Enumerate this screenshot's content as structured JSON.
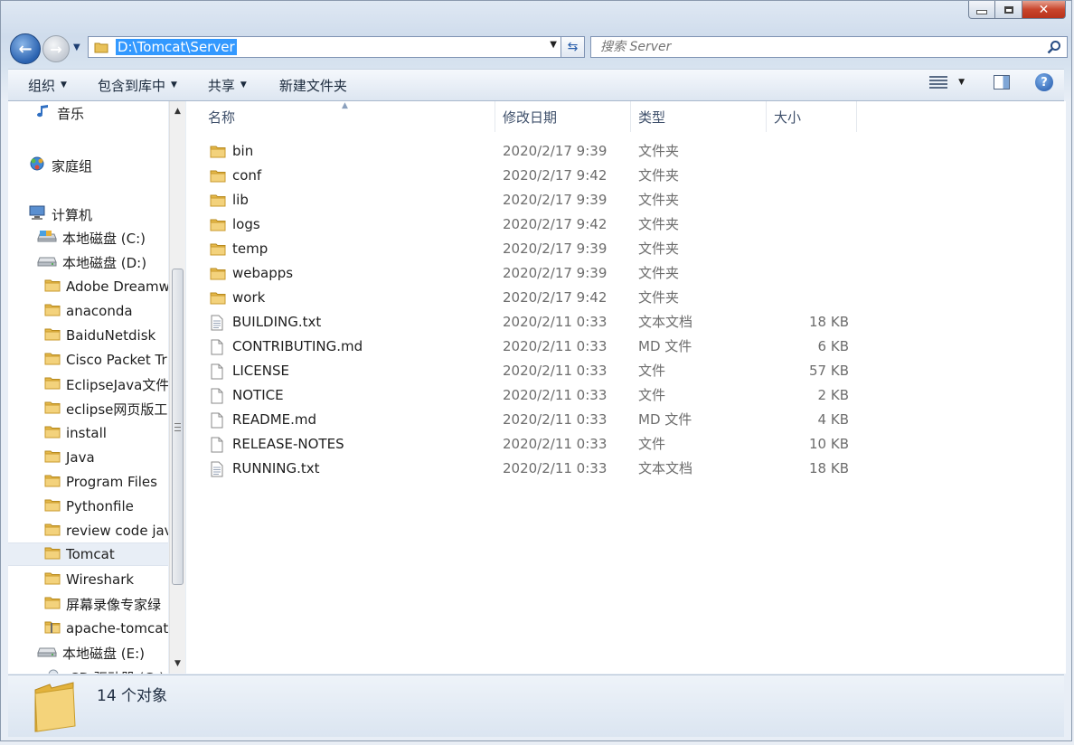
{
  "window": {
    "caption_buttons": [
      "minimize-icon",
      "maximize-icon",
      "close-icon"
    ],
    "close_glyph": "✕"
  },
  "nav": {
    "back_glyph": "←",
    "forward_glyph": "→",
    "address": "D:\\Tomcat\\Server",
    "search_placeholder": "搜索 Server"
  },
  "toolbar": {
    "organize": "组织",
    "include_in_library": "包含到库中",
    "share": "共享",
    "new_folder": "新建文件夹"
  },
  "sidebar": {
    "items": [
      {
        "label": "音乐",
        "icon": "music-icon"
      },
      {
        "label": "家庭组",
        "icon": "homegroup-icon"
      },
      {
        "label": "计算机",
        "icon": "computer-icon"
      },
      {
        "label": "本地磁盘 (C:)",
        "icon": "drive-c-icon"
      },
      {
        "label": "本地磁盘 (D:)",
        "icon": "drive-icon"
      },
      {
        "label": "Adobe Dreamw",
        "icon": "folder-icon"
      },
      {
        "label": "anaconda",
        "icon": "folder-icon"
      },
      {
        "label": "BaiduNetdisk",
        "icon": "folder-icon"
      },
      {
        "label": "Cisco Packet Tr",
        "icon": "folder-icon"
      },
      {
        "label": "EclipseJava文件",
        "icon": "folder-icon"
      },
      {
        "label": "eclipse网页版工",
        "icon": "folder-icon"
      },
      {
        "label": "install",
        "icon": "folder-icon"
      },
      {
        "label": "Java",
        "icon": "folder-icon"
      },
      {
        "label": "Program Files",
        "icon": "folder-icon"
      },
      {
        "label": "Pythonfile",
        "icon": "folder-icon"
      },
      {
        "label": "review code jav",
        "icon": "folder-icon"
      },
      {
        "label": "Tomcat",
        "icon": "folder-icon",
        "selected": true
      },
      {
        "label": "Wireshark",
        "icon": "folder-icon"
      },
      {
        "label": "屏幕录像专家绿",
        "icon": "folder-icon"
      },
      {
        "label": "apache-tomcat",
        "icon": "zip-folder-icon"
      },
      {
        "label": "本地磁盘 (E:)",
        "icon": "drive-icon"
      },
      {
        "label": "CD 驱动器 (G:)",
        "icon": "cd-drive-icon"
      }
    ]
  },
  "columns": {
    "name": "名称",
    "modified": "修改日期",
    "type": "类型",
    "size": "大小"
  },
  "files": [
    {
      "name": "bin",
      "modified": "2020/2/17 9:39",
      "type": "文件夹",
      "size": "",
      "icon": "folder-icon"
    },
    {
      "name": "conf",
      "modified": "2020/2/17 9:42",
      "type": "文件夹",
      "size": "",
      "icon": "folder-icon"
    },
    {
      "name": "lib",
      "modified": "2020/2/17 9:39",
      "type": "文件夹",
      "size": "",
      "icon": "folder-icon"
    },
    {
      "name": "logs",
      "modified": "2020/2/17 9:42",
      "type": "文件夹",
      "size": "",
      "icon": "folder-icon"
    },
    {
      "name": "temp",
      "modified": "2020/2/17 9:39",
      "type": "文件夹",
      "size": "",
      "icon": "folder-icon"
    },
    {
      "name": "webapps",
      "modified": "2020/2/17 9:39",
      "type": "文件夹",
      "size": "",
      "icon": "folder-icon"
    },
    {
      "name": "work",
      "modified": "2020/2/17 9:42",
      "type": "文件夹",
      "size": "",
      "icon": "folder-icon"
    },
    {
      "name": "BUILDING.txt",
      "modified": "2020/2/11 0:33",
      "type": "文本文档",
      "size": "18 KB",
      "icon": "text-file-icon"
    },
    {
      "name": "CONTRIBUTING.md",
      "modified": "2020/2/11 0:33",
      "type": "MD 文件",
      "size": "6 KB",
      "icon": "file-icon"
    },
    {
      "name": "LICENSE",
      "modified": "2020/2/11 0:33",
      "type": "文件",
      "size": "57 KB",
      "icon": "file-icon"
    },
    {
      "name": "NOTICE",
      "modified": "2020/2/11 0:33",
      "type": "文件",
      "size": "2 KB",
      "icon": "file-icon"
    },
    {
      "name": "README.md",
      "modified": "2020/2/11 0:33",
      "type": "MD 文件",
      "size": "4 KB",
      "icon": "file-icon"
    },
    {
      "name": "RELEASE-NOTES",
      "modified": "2020/2/11 0:33",
      "type": "文件",
      "size": "10 KB",
      "icon": "file-icon"
    },
    {
      "name": "RUNNING.txt",
      "modified": "2020/2/11 0:33",
      "type": "文本文档",
      "size": "18 KB",
      "icon": "text-file-icon"
    }
  ],
  "details": {
    "count": "14 个对象"
  }
}
